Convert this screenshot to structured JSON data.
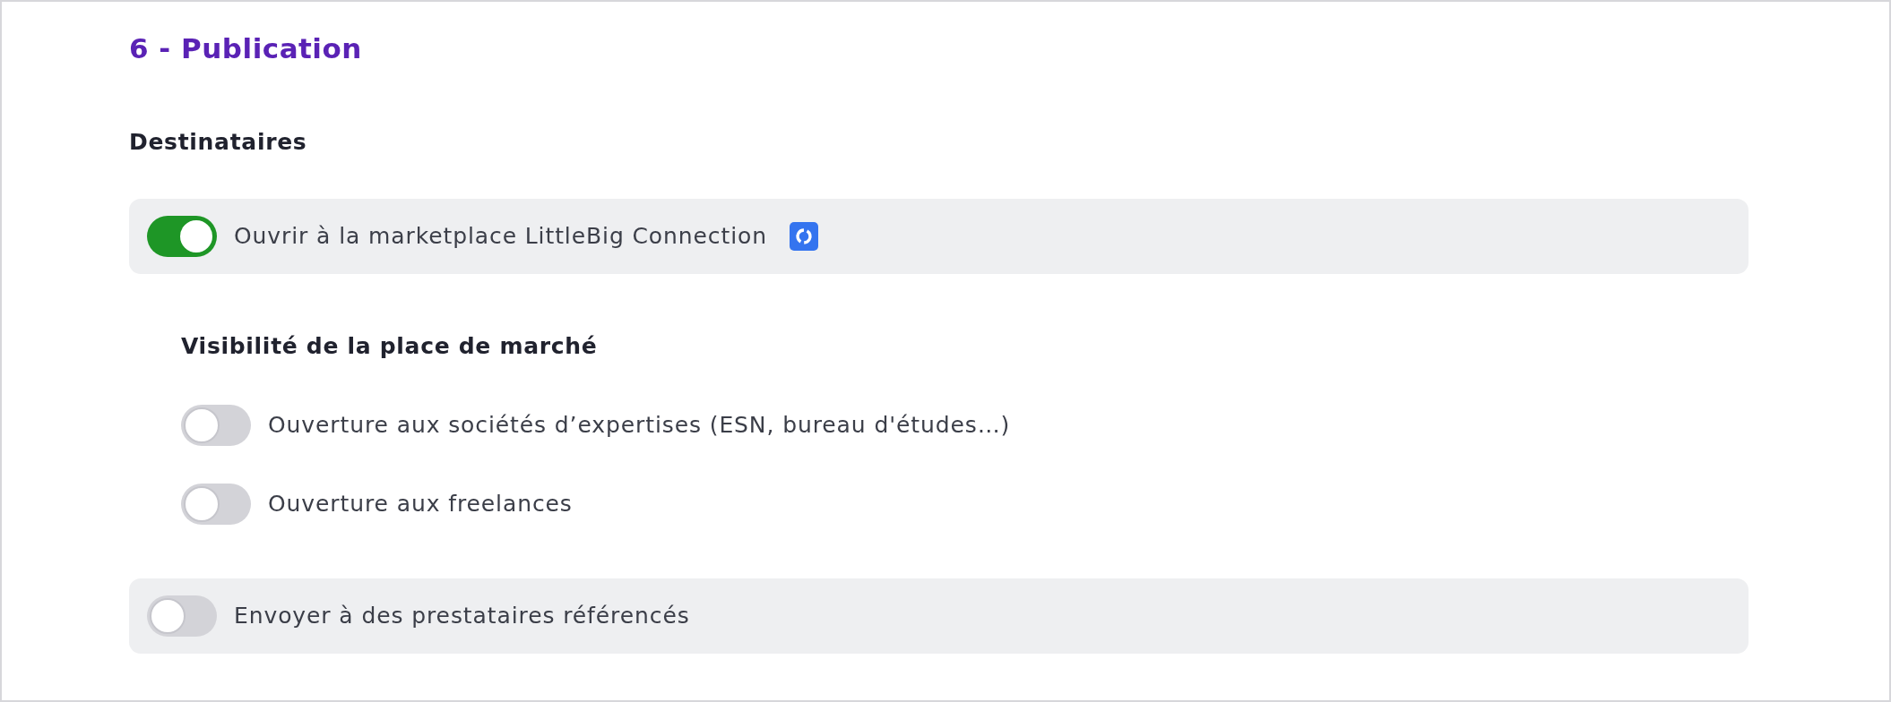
{
  "title": "6 - Publication",
  "recipients": {
    "heading": "Destinataires",
    "marketplace": {
      "label": "Ouvrir à la marketplace LittleBig Connection",
      "on": true
    },
    "visibility": {
      "heading": "Visibilité de la place de marché",
      "options": [
        {
          "label": "Ouverture aux sociétés d’expertises (ESN, bureau d'études…)",
          "on": false
        },
        {
          "label": "Ouverture aux freelances",
          "on": false
        }
      ]
    },
    "referenced": {
      "label": "Envoyer à des prestataires référencés",
      "on": false
    }
  }
}
